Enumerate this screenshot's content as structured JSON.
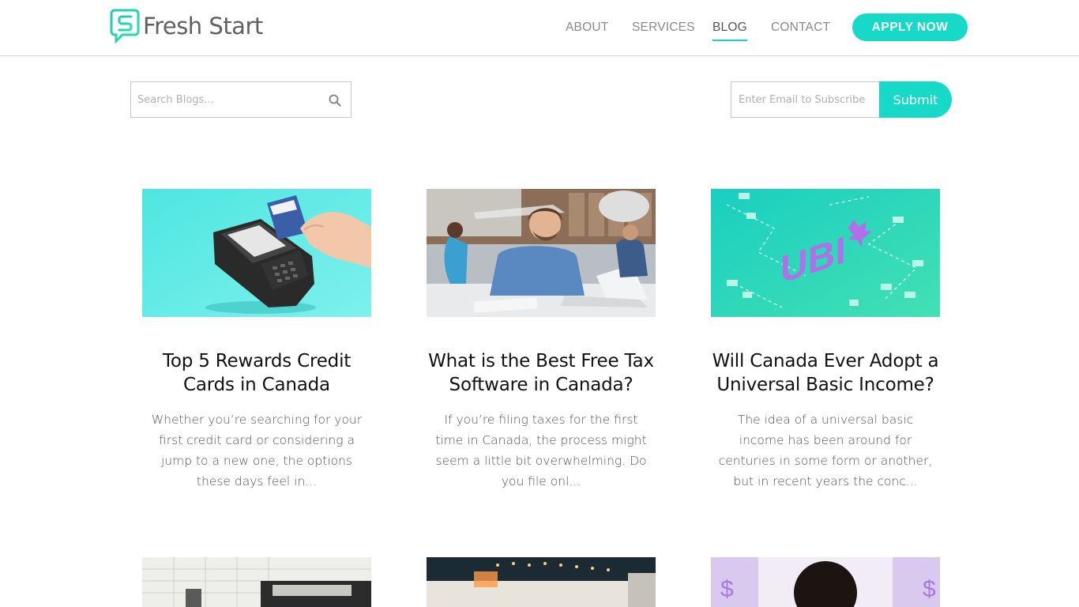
{
  "header": {
    "logo_text": "Fresh Start",
    "nav": [
      "ABOUT",
      "SERVICES",
      "BLOG",
      "CONTACT"
    ],
    "active_nav": "BLOG",
    "apply_label": "APPLY NOW"
  },
  "search": {
    "placeholder": "Search Blogs..."
  },
  "subscribe": {
    "placeholder": "Enter Email to Subscribe",
    "submit_label": "Submit"
  },
  "colors": {
    "accent": "#16d9c8",
    "nav_text": "#8a8a8a",
    "logo_text": "#5f6063"
  },
  "posts": [
    {
      "title": "Top 5 Rewards Credit Cards in Canada",
      "excerpt": "Whether you’re searching for your first credit card or considering a jump to a new one, the options these days feel in...",
      "image": "payment-terminal-image"
    },
    {
      "title": "What is the Best Free Tax Software in Canada?",
      "excerpt": "If you’re filing taxes for the first time in Canada, the process might seem a little bit overwhelming. Do you file onl...",
      "image": "man-at-laptop-image"
    },
    {
      "title": "Will Canada Ever Adopt a Universal Basic Income?",
      "excerpt": "The idea of a universal basic income has been around for centuries in some form or another, but in recent years the conc...",
      "image": "ubi-illustration-image",
      "image_text": "UBI"
    }
  ],
  "more_posts": [
    {
      "image": "calendar-calculator-image"
    },
    {
      "image": "evening-patio-image"
    },
    {
      "image": "woman-money-icons-image"
    }
  ]
}
